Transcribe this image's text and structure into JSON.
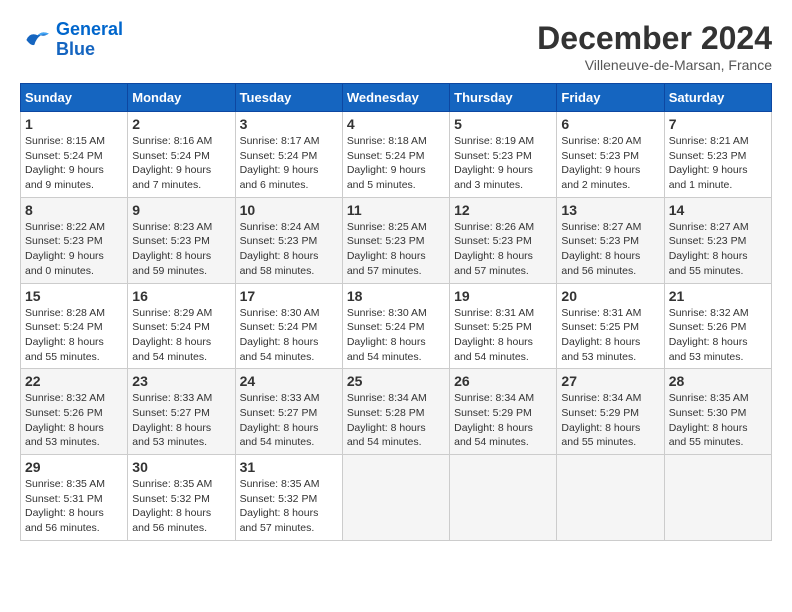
{
  "logo": {
    "line1": "General",
    "line2": "Blue"
  },
  "title": "December 2024",
  "subtitle": "Villeneuve-de-Marsan, France",
  "days_header": [
    "Sunday",
    "Monday",
    "Tuesday",
    "Wednesday",
    "Thursday",
    "Friday",
    "Saturday"
  ],
  "weeks": [
    [
      {
        "num": "1",
        "info": "Sunrise: 8:15 AM\nSunset: 5:24 PM\nDaylight: 9 hours\nand 9 minutes."
      },
      {
        "num": "2",
        "info": "Sunrise: 8:16 AM\nSunset: 5:24 PM\nDaylight: 9 hours\nand 7 minutes."
      },
      {
        "num": "3",
        "info": "Sunrise: 8:17 AM\nSunset: 5:24 PM\nDaylight: 9 hours\nand 6 minutes."
      },
      {
        "num": "4",
        "info": "Sunrise: 8:18 AM\nSunset: 5:24 PM\nDaylight: 9 hours\nand 5 minutes."
      },
      {
        "num": "5",
        "info": "Sunrise: 8:19 AM\nSunset: 5:23 PM\nDaylight: 9 hours\nand 3 minutes."
      },
      {
        "num": "6",
        "info": "Sunrise: 8:20 AM\nSunset: 5:23 PM\nDaylight: 9 hours\nand 2 minutes."
      },
      {
        "num": "7",
        "info": "Sunrise: 8:21 AM\nSunset: 5:23 PM\nDaylight: 9 hours\nand 1 minute."
      }
    ],
    [
      {
        "num": "8",
        "info": "Sunrise: 8:22 AM\nSunset: 5:23 PM\nDaylight: 9 hours\nand 0 minutes."
      },
      {
        "num": "9",
        "info": "Sunrise: 8:23 AM\nSunset: 5:23 PM\nDaylight: 8 hours\nand 59 minutes."
      },
      {
        "num": "10",
        "info": "Sunrise: 8:24 AM\nSunset: 5:23 PM\nDaylight: 8 hours\nand 58 minutes."
      },
      {
        "num": "11",
        "info": "Sunrise: 8:25 AM\nSunset: 5:23 PM\nDaylight: 8 hours\nand 57 minutes."
      },
      {
        "num": "12",
        "info": "Sunrise: 8:26 AM\nSunset: 5:23 PM\nDaylight: 8 hours\nand 57 minutes."
      },
      {
        "num": "13",
        "info": "Sunrise: 8:27 AM\nSunset: 5:23 PM\nDaylight: 8 hours\nand 56 minutes."
      },
      {
        "num": "14",
        "info": "Sunrise: 8:27 AM\nSunset: 5:23 PM\nDaylight: 8 hours\nand 55 minutes."
      }
    ],
    [
      {
        "num": "15",
        "info": "Sunrise: 8:28 AM\nSunset: 5:24 PM\nDaylight: 8 hours\nand 55 minutes."
      },
      {
        "num": "16",
        "info": "Sunrise: 8:29 AM\nSunset: 5:24 PM\nDaylight: 8 hours\nand 54 minutes."
      },
      {
        "num": "17",
        "info": "Sunrise: 8:30 AM\nSunset: 5:24 PM\nDaylight: 8 hours\nand 54 minutes."
      },
      {
        "num": "18",
        "info": "Sunrise: 8:30 AM\nSunset: 5:24 PM\nDaylight: 8 hours\nand 54 minutes."
      },
      {
        "num": "19",
        "info": "Sunrise: 8:31 AM\nSunset: 5:25 PM\nDaylight: 8 hours\nand 54 minutes."
      },
      {
        "num": "20",
        "info": "Sunrise: 8:31 AM\nSunset: 5:25 PM\nDaylight: 8 hours\nand 53 minutes."
      },
      {
        "num": "21",
        "info": "Sunrise: 8:32 AM\nSunset: 5:26 PM\nDaylight: 8 hours\nand 53 minutes."
      }
    ],
    [
      {
        "num": "22",
        "info": "Sunrise: 8:32 AM\nSunset: 5:26 PM\nDaylight: 8 hours\nand 53 minutes."
      },
      {
        "num": "23",
        "info": "Sunrise: 8:33 AM\nSunset: 5:27 PM\nDaylight: 8 hours\nand 53 minutes."
      },
      {
        "num": "24",
        "info": "Sunrise: 8:33 AM\nSunset: 5:27 PM\nDaylight: 8 hours\nand 54 minutes."
      },
      {
        "num": "25",
        "info": "Sunrise: 8:34 AM\nSunset: 5:28 PM\nDaylight: 8 hours\nand 54 minutes."
      },
      {
        "num": "26",
        "info": "Sunrise: 8:34 AM\nSunset: 5:29 PM\nDaylight: 8 hours\nand 54 minutes."
      },
      {
        "num": "27",
        "info": "Sunrise: 8:34 AM\nSunset: 5:29 PM\nDaylight: 8 hours\nand 55 minutes."
      },
      {
        "num": "28",
        "info": "Sunrise: 8:35 AM\nSunset: 5:30 PM\nDaylight: 8 hours\nand 55 minutes."
      }
    ],
    [
      {
        "num": "29",
        "info": "Sunrise: 8:35 AM\nSunset: 5:31 PM\nDaylight: 8 hours\nand 56 minutes."
      },
      {
        "num": "30",
        "info": "Sunrise: 8:35 AM\nSunset: 5:32 PM\nDaylight: 8 hours\nand 56 minutes."
      },
      {
        "num": "31",
        "info": "Sunrise: 8:35 AM\nSunset: 5:32 PM\nDaylight: 8 hours\nand 57 minutes."
      },
      null,
      null,
      null,
      null
    ]
  ]
}
